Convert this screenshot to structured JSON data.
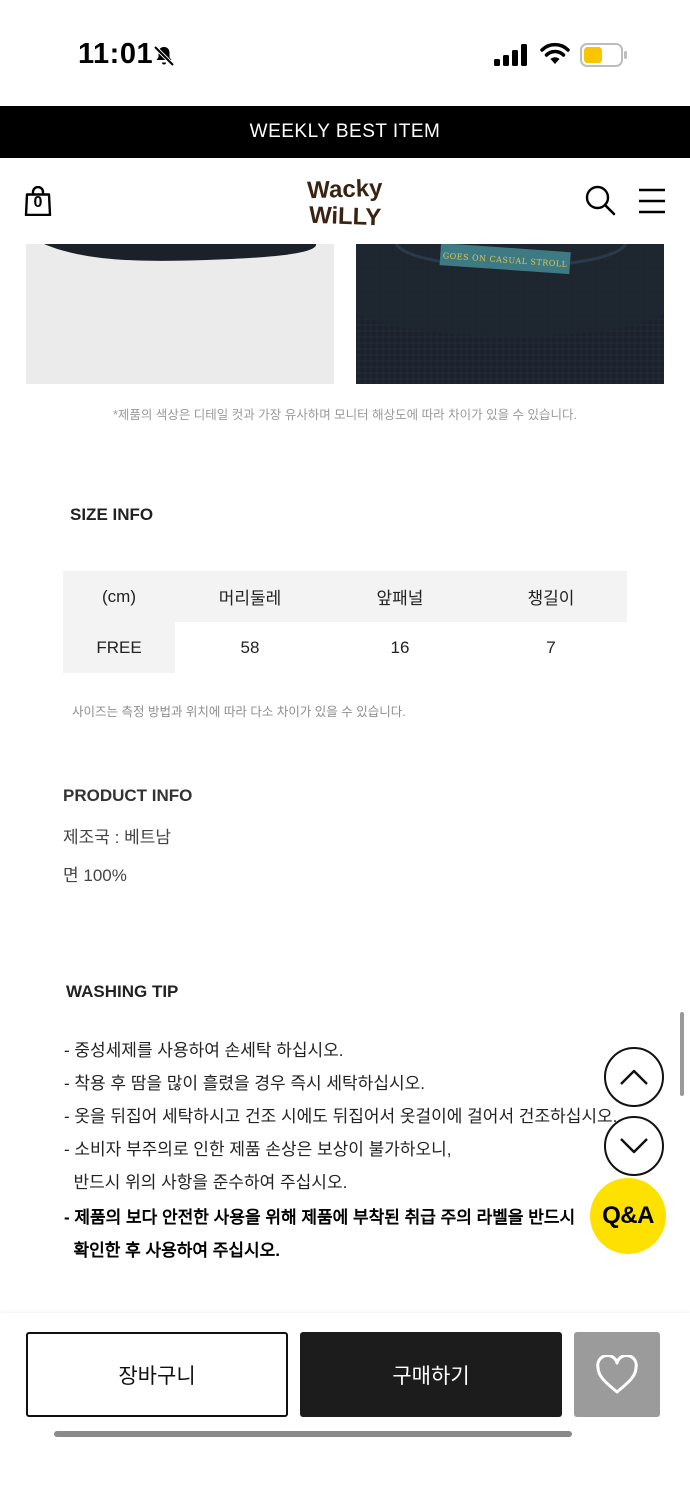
{
  "status_bar": {
    "time": "11:01"
  },
  "promo_banner": {
    "text": "WEEKLY BEST ITEM"
  },
  "header": {
    "cart_count": "0",
    "logo_lines": [
      "Wacky",
      "WiLLY"
    ]
  },
  "product_images": {
    "right_label": "GOES ON CASUAL STROLL"
  },
  "color_note": "*제품의 색상은 디테일 컷과 가장 유사하며 모니터 해상도에 따라 차이가 있을 수 있습니다.",
  "size_info": {
    "title": "SIZE INFO",
    "headers": [
      "(cm)",
      "머리둘레",
      "앞패널",
      "챙길이"
    ],
    "rows": [
      [
        "FREE",
        "58",
        "16",
        "7"
      ]
    ],
    "note": "사이즈는 측정 방법과 위치에 따라 다소 차이가 있을 수 있습니다."
  },
  "product_info": {
    "title": "PRODUCT INFO",
    "lines": [
      "제조국 : 베트남",
      "면 100%"
    ]
  },
  "washing_tip": {
    "title": "WASHING TIP",
    "lines": [
      "- 중성세제를 사용하여 손세탁 하십시오.",
      "- 착용 후 땀을 많이 흘렸을 경우 즉시 세탁하십시오.",
      "- 옷을 뒤집어 세탁하시고 건조 시에도 뒤집어서 옷걸이에 걸어서 건조하십시오.",
      "- 소비자 부주의로 인한 제품 손상은 보상이 불가하오니,",
      "  반드시 위의 사항을 준수하여 주십시오."
    ],
    "bold_lines": [
      "- 제품의 보다 안전한 사용을 위해 제품에 부착된 취급 주의 라벨을 반드시",
      "  확인한 후 사용하여 주십시오."
    ]
  },
  "floating": {
    "qa_label": "Q&A"
  },
  "bottom_bar": {
    "cart_label": "장바구니",
    "buy_label": "구매하기"
  },
  "colors": {
    "qa_yellow": "#ffe100",
    "battery_yellow": "#f7c600",
    "buy_dark": "#1c1c1c",
    "like_gray": "#9b9b9b"
  }
}
